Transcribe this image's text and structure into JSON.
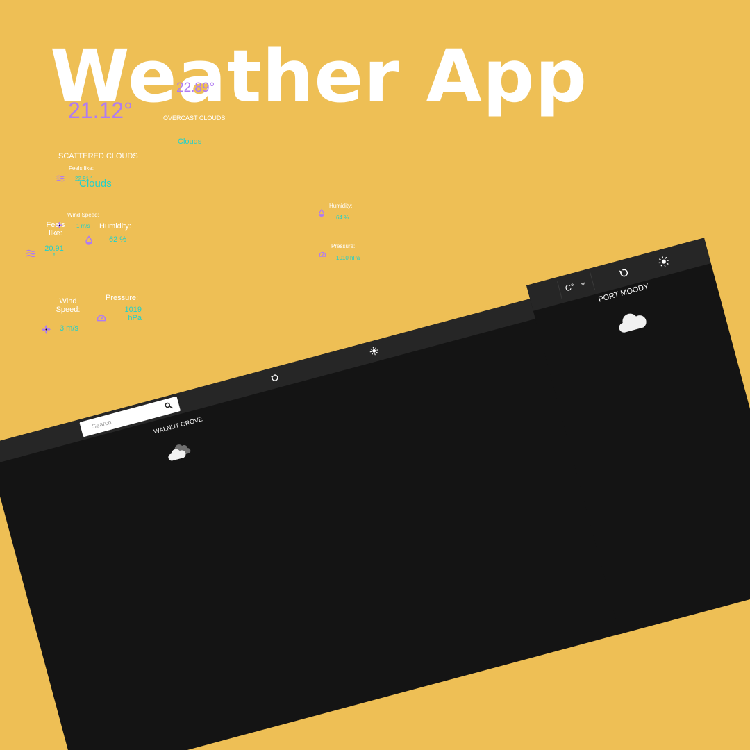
{
  "headline": "Weather App",
  "colors": {
    "background": "#EEBF55",
    "screen": "#141414",
    "topbar": "#262626",
    "accent_purple": "#B07BF2",
    "accent_teal": "#1FD1CC"
  },
  "desktop": {
    "search": {
      "placeholder": "Search",
      "icon": "search-icon"
    },
    "toolbar_icons": [
      "refresh-icon",
      "sun-icon"
    ],
    "weather": {
      "location": "WALNUT GROVE",
      "icon": "cloud-icon",
      "temperature": "22.89°",
      "description": "OVERCAST CLOUDS",
      "main": "Clouds"
    },
    "stats": {
      "feels_like": {
        "label": "Feels like:",
        "value": "22.91 °",
        "icon": "wind-waves-icon"
      },
      "wind_speed": {
        "label": "Wind Speed:",
        "value": "1 m/s",
        "icon": "fan-icon"
      },
      "humidity": {
        "label": "Humidity:",
        "value": "64 %",
        "icon": "droplet-icon"
      },
      "pressure": {
        "label": "Pressure:",
        "value": "1010 hPa",
        "icon": "gauge-icon"
      }
    }
  },
  "mobile": {
    "unit_select": {
      "value": "C°",
      "icon": "caret-down-icon"
    },
    "toolbar_icons": [
      "refresh-icon",
      "sun-icon"
    ],
    "weather": {
      "location": "PORT MOODY",
      "icon": "cloud-icon",
      "temperature": "21.12°",
      "description": "SCATTERED CLOUDS",
      "main": "Clouds"
    },
    "stats": {
      "feels_like": {
        "label_line1": "Feels",
        "label_line2": "like:",
        "value_line1": "20.91",
        "value_line2": "°",
        "icon": "wind-waves-icon"
      },
      "humidity": {
        "label": "Humidity:",
        "value": "62 %",
        "icon": "droplet-icon"
      },
      "wind_speed": {
        "label_line1": "Wind",
        "label_line2": "Speed:",
        "value": "3 m/s",
        "icon": "fan-icon"
      },
      "pressure": {
        "label": "Pressure:",
        "value_line1": "1019",
        "value_line2": "hPa",
        "icon": "gauge-icon"
      }
    }
  }
}
